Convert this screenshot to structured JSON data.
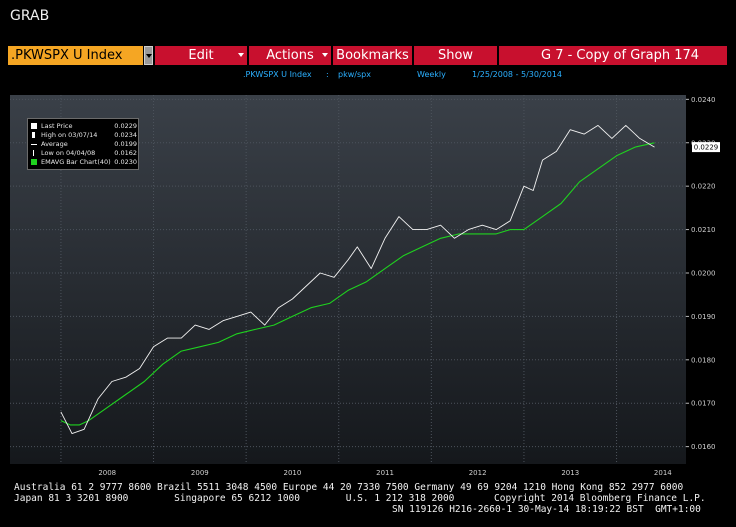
{
  "window": {
    "title": "GRAB"
  },
  "toolbar": {
    "ticker": ".PKWSPX U Index",
    "edit_label": "Edit",
    "actions_label": "Actions",
    "bookmarks_label": "Bookmarks",
    "show_label": "Show",
    "graph_title": "G 7 - Copy of Graph 174",
    "accent_color": "#c8102e",
    "ticker_color": "#f5a623"
  },
  "subheader": {
    "security": ".PKWSPX U Index",
    "separator": ":",
    "ratio": "pkw/spx",
    "frequency": "Weekly",
    "date_range": "1/25/2008 - 5/30/2014"
  },
  "legend": {
    "last_price": {
      "label": "Last Price",
      "value": "0.0229"
    },
    "high": {
      "label": "High on 03/07/14",
      "value": "0.0234"
    },
    "average": {
      "label": "Average",
      "value": "0.0199"
    },
    "low": {
      "label": "Low on 04/04/08",
      "value": "0.0162"
    },
    "emavg": {
      "label": "EMAVG Bar Chart(40)",
      "value": "0.0230"
    }
  },
  "chart_data": {
    "type": "line",
    "ylim": [
      0.0156,
      0.0241
    ],
    "y_ticks": [
      "0.0160",
      "0.0170",
      "0.0180",
      "0.0190",
      "0.0200",
      "0.0210",
      "0.0220",
      "0.0230",
      "0.0240"
    ],
    "x_ticks": [
      "2008",
      "2009",
      "2010",
      "2011",
      "2012",
      "2013",
      "2014"
    ],
    "last_value_label": "0.0229",
    "series": [
      {
        "name": "Last Price",
        "color": "#f2f2f2",
        "x": [
          2008.0,
          2008.12,
          2008.25,
          2008.4,
          2008.55,
          2008.7,
          2008.85,
          2009.0,
          2009.15,
          2009.3,
          2009.45,
          2009.6,
          2009.75,
          2009.9,
          2010.05,
          2010.2,
          2010.35,
          2010.5,
          2010.65,
          2010.8,
          2010.95,
          2011.1,
          2011.2,
          2011.35,
          2011.5,
          2011.65,
          2011.8,
          2011.95,
          2012.1,
          2012.25,
          2012.4,
          2012.55,
          2012.7,
          2012.85,
          2013.0,
          2013.1,
          2013.2,
          2013.35,
          2013.5,
          2013.65,
          2013.8,
          2013.95,
          2014.1,
          2014.25,
          2014.41
        ],
        "values": [
          0.0168,
          0.0163,
          0.0164,
          0.0171,
          0.0175,
          0.0176,
          0.0178,
          0.0183,
          0.0185,
          0.0185,
          0.0188,
          0.0187,
          0.0189,
          0.019,
          0.0191,
          0.0188,
          0.0192,
          0.0194,
          0.0197,
          0.02,
          0.0199,
          0.0203,
          0.0206,
          0.0201,
          0.0208,
          0.0213,
          0.021,
          0.021,
          0.0211,
          0.0208,
          0.021,
          0.0211,
          0.021,
          0.0212,
          0.022,
          0.0219,
          0.0226,
          0.0228,
          0.0233,
          0.0232,
          0.0234,
          0.0231,
          0.0234,
          0.0231,
          0.0229
        ]
      },
      {
        "name": "EMAVG Bar Chart(40)",
        "color": "#1fd21f",
        "x": [
          2008.0,
          2008.1,
          2008.2,
          2008.3,
          2008.5,
          2008.7,
          2008.9,
          2009.1,
          2009.3,
          2009.5,
          2009.7,
          2009.9,
          2010.1,
          2010.3,
          2010.5,
          2010.7,
          2010.9,
          2011.1,
          2011.3,
          2011.5,
          2011.7,
          2011.9,
          2012.1,
          2012.3,
          2012.5,
          2012.7,
          2012.85,
          2013.0,
          2013.2,
          2013.4,
          2013.6,
          2013.8,
          2014.0,
          2014.2,
          2014.41
        ],
        "values": [
          0.0166,
          0.0165,
          0.0165,
          0.0166,
          0.0169,
          0.0172,
          0.0175,
          0.0179,
          0.0182,
          0.0183,
          0.0184,
          0.0186,
          0.0187,
          0.0188,
          0.019,
          0.0192,
          0.0193,
          0.0196,
          0.0198,
          0.0201,
          0.0204,
          0.0206,
          0.0208,
          0.0209,
          0.0209,
          0.0209,
          0.021,
          0.021,
          0.0213,
          0.0216,
          0.0221,
          0.0224,
          0.0227,
          0.0229,
          0.023
        ]
      }
    ],
    "grid": true,
    "legend_position": "top-left"
  },
  "footer": {
    "line1": "Australia 61 2 9777 8600 Brazil 5511 3048 4500 Europe 44 20 7330 7500 Germany 49 69 9204 1210 Hong Kong 852 2977 6000",
    "line2_left": "Japan 81 3 3201 8900        Singapore 65 6212 1000        U.S. 1 212 318 2000",
    "line2_right": "Copyright 2014 Bloomberg Finance L.P.",
    "line3": "SN 119126 H216-2660-1 30-May-14 18:19:22 BST  GMT+1:00"
  }
}
